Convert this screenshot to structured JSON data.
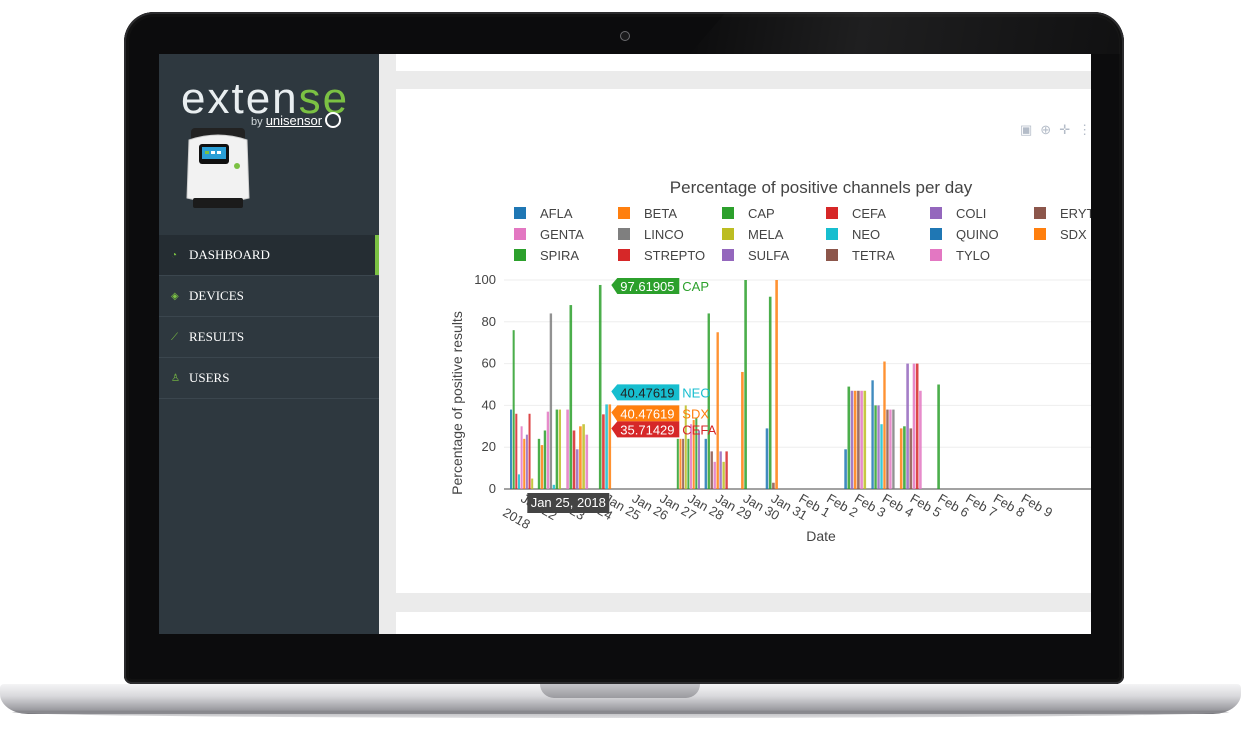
{
  "app": {
    "brand": "exten",
    "brand_suffix": "se",
    "byline_prefix": "by",
    "byline_company": "unisensor"
  },
  "sidebar": {
    "items": [
      {
        "label": "DASHBOARD",
        "icon": "gauge-icon",
        "active": true
      },
      {
        "label": "DEVICES",
        "icon": "layers-icon",
        "active": false
      },
      {
        "label": "RESULTS",
        "icon": "line-chart-icon",
        "active": false
      },
      {
        "label": "USERS",
        "icon": "user-icon",
        "active": false
      }
    ]
  },
  "modebar": [
    "camera-icon",
    "zoom-icon",
    "pan-icon"
  ],
  "colors": {
    "accent": "#7bc143",
    "sidebar_bg": "#2e383f"
  },
  "chart_data": {
    "type": "bar",
    "title": "Percentage of positive channels per day",
    "xlabel": "Date",
    "ylabel": "Percentage of positive results",
    "ylim": [
      0,
      100
    ],
    "yticks": [
      "0",
      "20",
      "40",
      "60",
      "80",
      "100"
    ],
    "categories": [
      "Jan 22 2018",
      "Jan 23",
      "Jan 24",
      "Jan 25",
      "Jan 26",
      "Jan 27",
      "Jan 28",
      "Jan 29",
      "Jan 30",
      "Jan 31",
      "Feb 1",
      "Feb 2",
      "Feb 3",
      "Feb 4",
      "Feb 5",
      "Feb 6",
      "Feb 7",
      "Feb 8",
      "Feb 9"
    ],
    "xtick_labels": [
      {
        "line1": "Jan 22",
        "line2": "2018"
      },
      {
        "line1": "Jan 23",
        "line2": ""
      },
      {
        "line1": "Jan 24",
        "line2": ""
      },
      {
        "line1": "Jan 25",
        "line2": ""
      },
      {
        "line1": "Jan 26",
        "line2": ""
      },
      {
        "line1": "Jan 27",
        "line2": ""
      },
      {
        "line1": "Jan 28",
        "line2": ""
      },
      {
        "line1": "Jan 29",
        "line2": ""
      },
      {
        "line1": "Jan 30",
        "line2": ""
      },
      {
        "line1": "Jan 31",
        "line2": ""
      },
      {
        "line1": "Feb 1",
        "line2": ""
      },
      {
        "line1": "Feb 2",
        "line2": ""
      },
      {
        "line1": "Feb 3",
        "line2": ""
      },
      {
        "line1": "Feb 4",
        "line2": ""
      },
      {
        "line1": "Feb 5",
        "line2": ""
      },
      {
        "line1": "Feb 6",
        "line2": ""
      },
      {
        "line1": "Feb 7",
        "line2": ""
      },
      {
        "line1": "Feb 8",
        "line2": ""
      },
      {
        "line1": "Feb 9",
        "line2": ""
      }
    ],
    "legend_placement": "top",
    "legend": [
      {
        "name": "AFLA",
        "color": "#1f77b4"
      },
      {
        "name": "BETA",
        "color": "#ff7f0e"
      },
      {
        "name": "CAP",
        "color": "#2ca02c"
      },
      {
        "name": "CEFA",
        "color": "#d62728"
      },
      {
        "name": "COLI",
        "color": "#9467bd"
      },
      {
        "name": "ERYTH",
        "color": "#8c564b"
      },
      {
        "name": "GENTA",
        "color": "#e377c2"
      },
      {
        "name": "LINCO",
        "color": "#7f7f7f"
      },
      {
        "name": "MELA",
        "color": "#bcbd22"
      },
      {
        "name": "NEO",
        "color": "#17becf"
      },
      {
        "name": "QUINO",
        "color": "#1f77b4"
      },
      {
        "name": "SDX",
        "color": "#ff7f0e"
      },
      {
        "name": "SPIRA",
        "color": "#2ca02c"
      },
      {
        "name": "STREPTO",
        "color": "#d62728"
      },
      {
        "name": "SULFA",
        "color": "#9467bd"
      },
      {
        "name": "TETRA",
        "color": "#8c564b"
      },
      {
        "name": "TYLO",
        "color": "#e377c2"
      }
    ],
    "bar_groups": [
      {
        "category": "Jan 22 2018",
        "bars": [
          {
            "series": "AFLA",
            "value": 38
          },
          {
            "series": "CAP",
            "value": 76
          },
          {
            "series": "CEFA",
            "value": 36
          },
          {
            "series": "NEO",
            "value": 7
          },
          {
            "series": "GENTA",
            "value": 30
          },
          {
            "series": "BETA",
            "value": 24
          },
          {
            "series": "COLI",
            "value": 26
          },
          {
            "series": "CEFA",
            "value": 36
          },
          {
            "series": "MELA",
            "value": 5
          }
        ]
      },
      {
        "category": "Jan 23",
        "bars": [
          {
            "series": "SPIRA",
            "value": 24
          },
          {
            "series": "BETA",
            "value": 21
          },
          {
            "series": "CAP",
            "value": 28
          },
          {
            "series": "GENTA",
            "value": 37
          },
          {
            "series": "LINCO",
            "value": 84
          },
          {
            "series": "NEO",
            "value": 2
          },
          {
            "series": "CAP",
            "value": 38
          },
          {
            "series": "MELA",
            "value": 38
          }
        ]
      },
      {
        "category": "Jan 24",
        "bars": [
          {
            "series": "TYLO",
            "value": 38
          },
          {
            "series": "CAP",
            "value": 88
          },
          {
            "series": "STREPTO",
            "value": 28
          },
          {
            "series": "COLI",
            "value": 19
          },
          {
            "series": "BETA",
            "value": 30
          },
          {
            "series": "MELA",
            "value": 31
          },
          {
            "series": "GENTA",
            "value": 26
          }
        ]
      },
      {
        "category": "Jan 25",
        "bars": [
          {
            "series": "CAP",
            "value": 97.61905
          },
          {
            "series": "CEFA",
            "value": 35.71429
          },
          {
            "series": "NEO",
            "value": 40.47619
          },
          {
            "series": "SDX",
            "value": 40.47619
          }
        ]
      },
      {
        "category": "Jan 28",
        "bars": [
          {
            "series": "CAP",
            "value": 24
          },
          {
            "series": "BETA",
            "value": 24
          },
          {
            "series": "TETRA",
            "value": 24
          },
          {
            "series": "MELA",
            "value": 40
          },
          {
            "series": "CAP",
            "value": 24
          },
          {
            "series": "GENTA",
            "value": 31
          },
          {
            "series": "BETA",
            "value": 33
          },
          {
            "series": "CAP",
            "value": 34
          },
          {
            "series": "COLI",
            "value": 28
          }
        ]
      },
      {
        "category": "Jan 29",
        "bars": [
          {
            "series": "AFLA",
            "value": 24
          },
          {
            "series": "CAP",
            "value": 84
          },
          {
            "series": "TETRA",
            "value": 18
          },
          {
            "series": "GENTA",
            "value": 13
          },
          {
            "series": "BETA",
            "value": 75
          },
          {
            "series": "COLI",
            "value": 18
          },
          {
            "series": "MELA",
            "value": 13
          },
          {
            "series": "STREPTO",
            "value": 18
          }
        ]
      },
      {
        "category": "Jan 30",
        "bars": [
          {
            "series": "BETA",
            "value": 56
          },
          {
            "series": "CAP",
            "value": 100
          }
        ]
      },
      {
        "category": "Jan 31",
        "bars": [
          {
            "series": "AFLA",
            "value": 29
          },
          {
            "series": "CAP",
            "value": 92
          },
          {
            "series": "TETRA",
            "value": 3
          },
          {
            "series": "BETA",
            "value": 100
          }
        ]
      },
      {
        "category": "Feb 3",
        "bars": [
          {
            "series": "AFLA",
            "value": 19
          },
          {
            "series": "CAP",
            "value": 49
          },
          {
            "series": "COLI",
            "value": 47
          },
          {
            "series": "BETA",
            "value": 47
          },
          {
            "series": "TETRA",
            "value": 47
          },
          {
            "series": "GENTA",
            "value": 47
          },
          {
            "series": "MELA",
            "value": 47
          }
        ]
      },
      {
        "category": "Feb 4",
        "bars": [
          {
            "series": "AFLA",
            "value": 52
          },
          {
            "series": "CAP",
            "value": 40
          },
          {
            "series": "COLI",
            "value": 40
          },
          {
            "series": "NEO",
            "value": 31
          },
          {
            "series": "BETA",
            "value": 61
          },
          {
            "series": "TETRA",
            "value": 38
          },
          {
            "series": "GENTA",
            "value": 38
          },
          {
            "series": "LINCO",
            "value": 38
          }
        ]
      },
      {
        "category": "Feb 5",
        "bars": [
          {
            "series": "BETA",
            "value": 29
          },
          {
            "series": "CAP",
            "value": 30
          },
          {
            "series": "COLI",
            "value": 60
          },
          {
            "series": "TETRA",
            "value": 29
          },
          {
            "series": "GENTA",
            "value": 60
          },
          {
            "series": "STREPTO",
            "value": 60
          },
          {
            "series": "TYLO",
            "value": 47
          }
        ]
      },
      {
        "category": "Feb 6",
        "bars": [
          {
            "series": "CAP",
            "value": 50
          }
        ]
      }
    ],
    "hover": {
      "x_label": "Jan 25, 2018",
      "items": [
        {
          "value": "97.61905",
          "series": "CAP",
          "color": "#2ca02c"
        },
        {
          "value": "40.47619",
          "series": "NEO",
          "color": "#17becf"
        },
        {
          "value": "40.47619",
          "series": "SDX",
          "color": "#ff7f0e"
        },
        {
          "value": "35.71429",
          "series": "CEFA",
          "color": "#d62728"
        }
      ]
    }
  }
}
